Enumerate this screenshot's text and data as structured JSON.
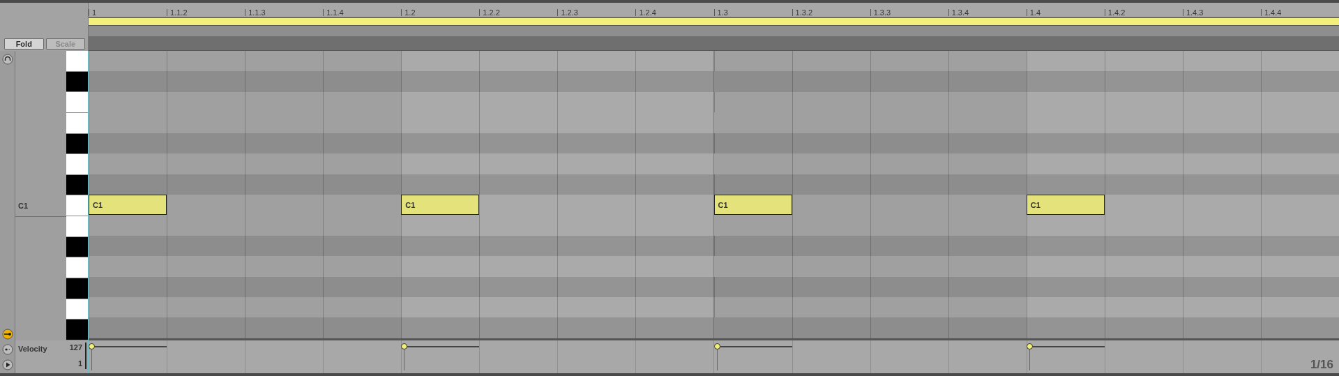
{
  "ruler": {
    "labels": [
      "1",
      "1.1.2",
      "1.1.3",
      "1.1.4",
      "1.2",
      "1.2.2",
      "1.2.3",
      "1.2.4",
      "1.3",
      "1.3.2",
      "1.3.3",
      "1.3.4",
      "1.4",
      "1.4.2",
      "1.4.3",
      "1.4.4"
    ]
  },
  "buttons": [
    {
      "label": "Fold",
      "on": true,
      "disabled": false
    },
    {
      "label": "Scale",
      "on": false,
      "disabled": true
    }
  ],
  "side_icons": [
    {
      "kind": "headphones",
      "on": false
    },
    {
      "kind": "pin",
      "on": true
    }
  ],
  "keys": [
    {
      "kind": "white"
    },
    {
      "kind": "black"
    },
    {
      "kind": "white"
    },
    {
      "kind": "white"
    },
    {
      "kind": "black"
    },
    {
      "kind": "white"
    },
    {
      "kind": "black"
    },
    {
      "kind": "white",
      "label": "C1"
    },
    {
      "kind": "white"
    },
    {
      "kind": "black"
    },
    {
      "kind": "white"
    },
    {
      "kind": "black"
    },
    {
      "kind": "white"
    },
    {
      "kind": "black"
    }
  ],
  "notes": [
    {
      "label": "C1",
      "level": 1
    },
    {
      "label": "C1",
      "level": 1
    },
    {
      "label": "C1",
      "level": 1
    },
    {
      "label": "C1",
      "level": 1
    }
  ],
  "velocity": {
    "label": "Velocity",
    "max": "127",
    "min": "1"
  },
  "grid": "1/16"
}
